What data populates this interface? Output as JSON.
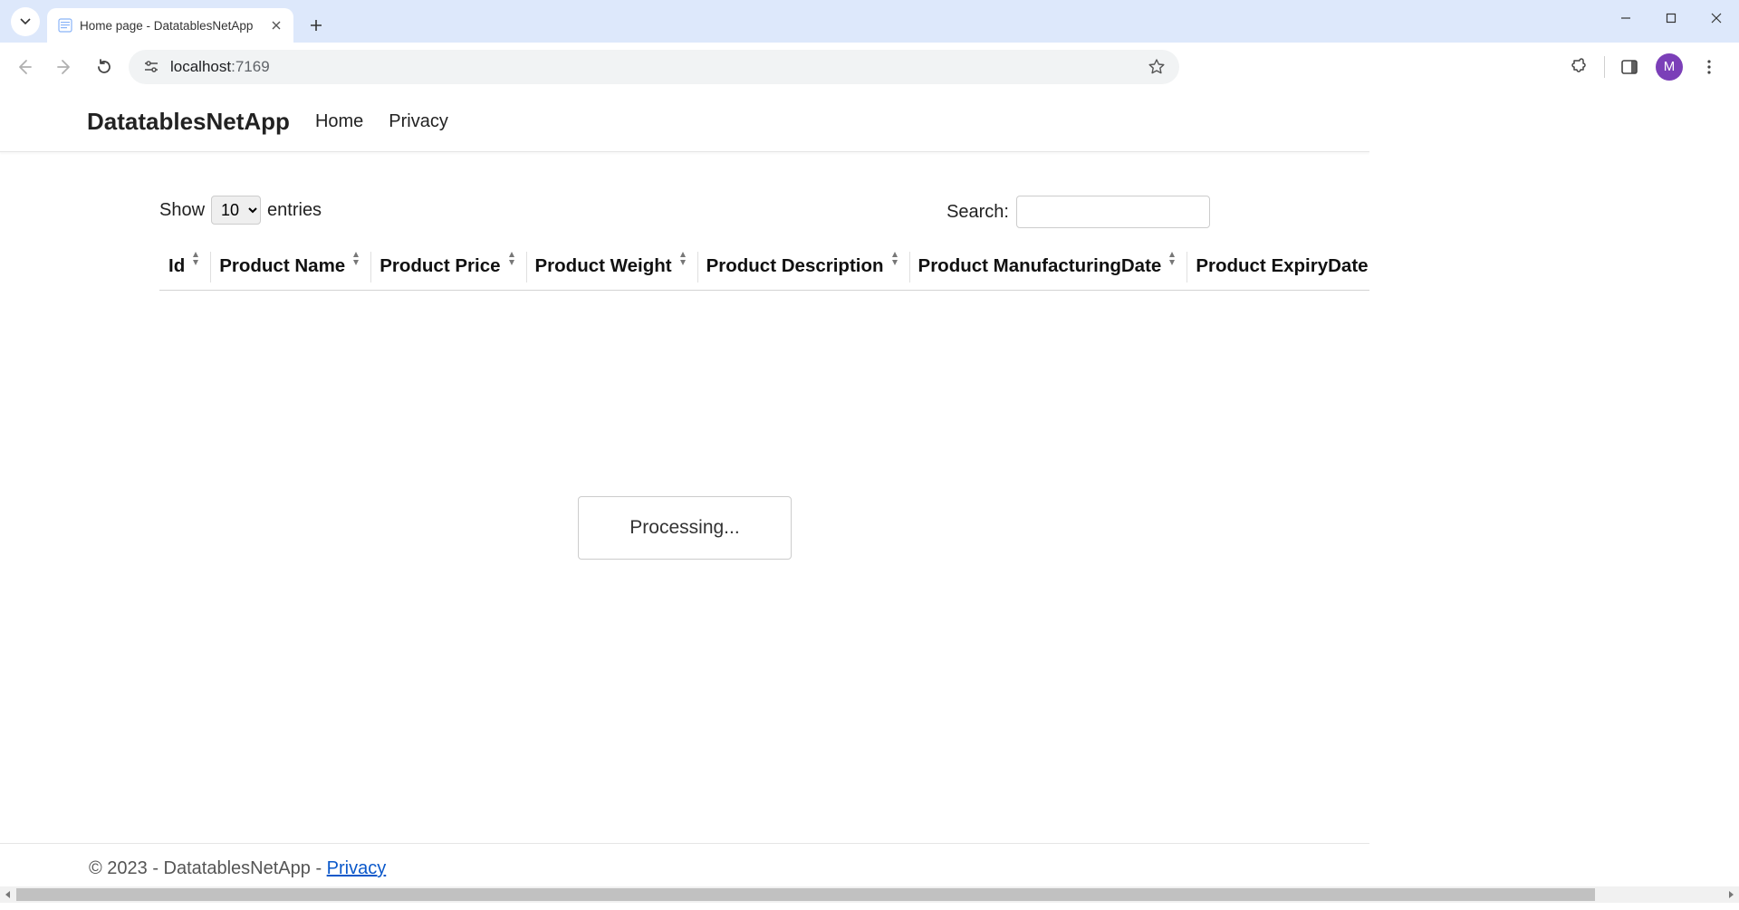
{
  "browser": {
    "tab_title": "Home page - DatatablesNetApp",
    "url_host": "localhost",
    "url_rest": ":7169",
    "avatar_initial": "M"
  },
  "nav": {
    "brand": "DatatablesNetApp",
    "links": {
      "home": "Home",
      "privacy": "Privacy"
    }
  },
  "datatable": {
    "length_prefix": "Show",
    "length_value": "10",
    "length_suffix": "entries",
    "search_label": "Search:",
    "search_value": "",
    "columns": [
      "Id",
      "Product Name",
      "Product Price",
      "Product Weight",
      "Product Description",
      "Product ManufacturingDate",
      "Product ExpiryDate"
    ],
    "processing_text": "Processing..."
  },
  "footer": {
    "copyright": "© 2023 - DatatablesNetApp - ",
    "privacy_link": "Privacy"
  }
}
